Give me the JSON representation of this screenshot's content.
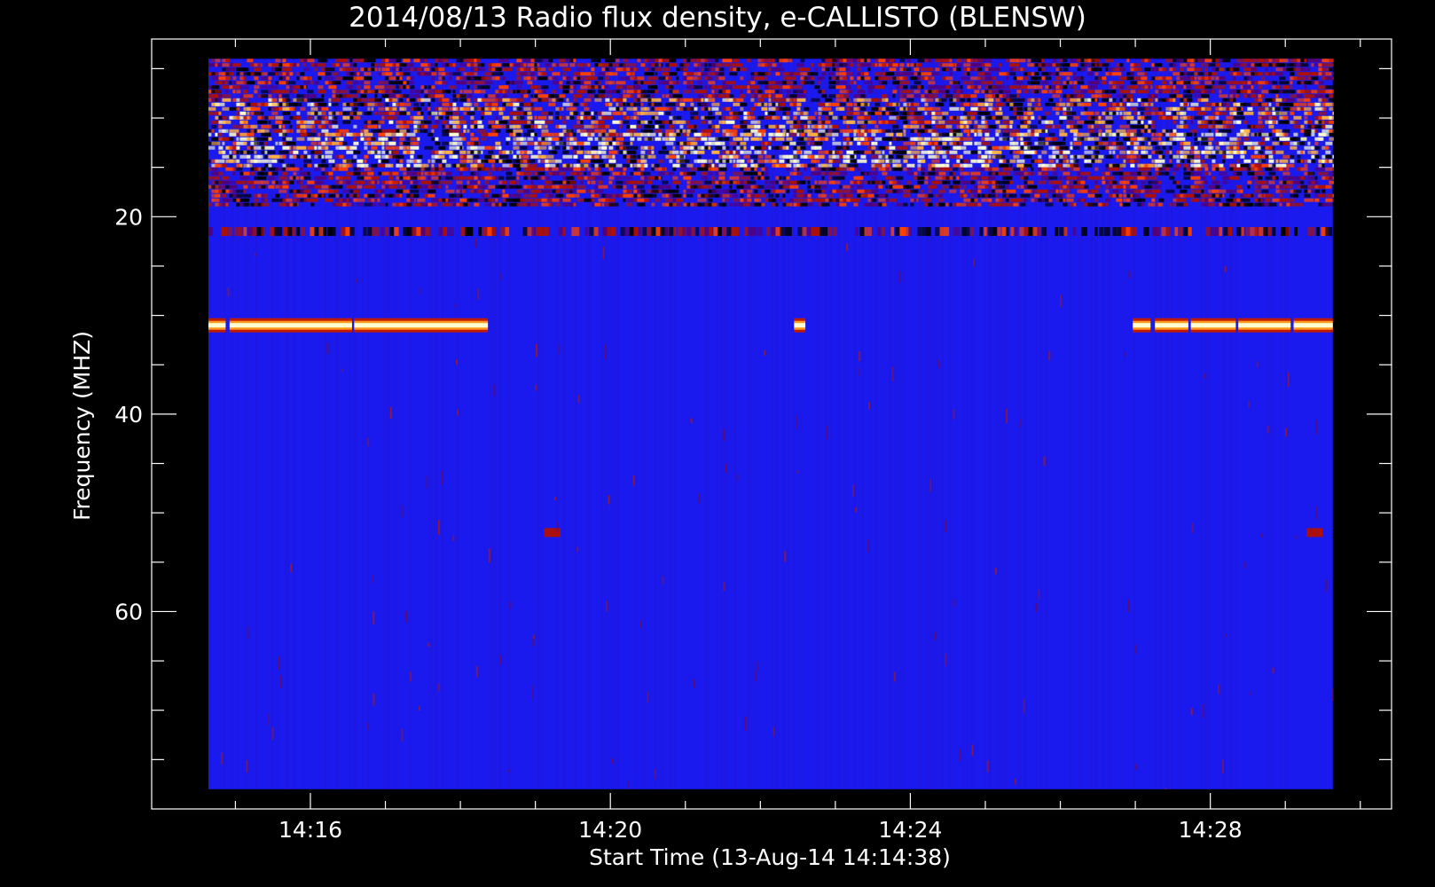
{
  "chart_data": {
    "type": "heatmap",
    "title": "2014/08/13  Radio flux density, e-CALLISTO (BLENSW)",
    "xlabel": "Start Time (13-Aug-14 14:14:38)",
    "ylabel": "Frequency (MHZ)",
    "x_unit": "UT time (HH:MM)",
    "xlim": [
      "14:13:53",
      "14:30:25"
    ],
    "data_xlim": [
      "14:14:38",
      "14:29:38"
    ],
    "ylim": [
      80,
      2
    ],
    "data_ylim": [
      78,
      4
    ],
    "x_major_ticks": [
      {
        "value": "14:16",
        "label": "14:16"
      },
      {
        "value": "14:20",
        "label": "14:20"
      },
      {
        "value": "14:24",
        "label": "14:24"
      },
      {
        "value": "14:28",
        "label": "14:28"
      }
    ],
    "x_minor_ticks": [
      "14:15",
      "14:17",
      "14:18",
      "14:19",
      "14:21",
      "14:22",
      "14:23",
      "14:25",
      "14:26",
      "14:27",
      "14:29",
      "14:30"
    ],
    "y_major_ticks": [
      {
        "value": 20,
        "label": "20"
      },
      {
        "value": 40,
        "label": "40"
      },
      {
        "value": 60,
        "label": "60"
      }
    ],
    "y_minor_ticks": [
      5,
      10,
      15,
      25,
      30,
      35,
      45,
      50,
      55,
      65,
      70,
      75
    ],
    "background_color": "#1a1aee",
    "colormap": [
      "#000000",
      "#550077",
      "#b01000",
      "#ff4000",
      "#ffb040",
      "#ffffd0"
    ],
    "features": [
      {
        "kind": "noisy-band",
        "freq_mhz": [
          4,
          8
        ],
        "intensity": "medium"
      },
      {
        "kind": "noisy-band",
        "freq_mhz": [
          8,
          11.5
        ],
        "intensity": "high"
      },
      {
        "kind": "noisy-band",
        "freq_mhz": [
          11.5,
          15
        ],
        "intensity": "very-high"
      },
      {
        "kind": "noisy-band",
        "freq_mhz": [
          15,
          19
        ],
        "intensity": "medium"
      },
      {
        "kind": "line",
        "freq_mhz": 21.5,
        "intensity": "medium"
      },
      {
        "kind": "carrier",
        "freq_mhz": 31,
        "time": [
          "14:14:38",
          "14:18:22"
        ]
      },
      {
        "kind": "carrier",
        "freq_mhz": 31,
        "time": [
          "14:22:27",
          "14:22:36"
        ]
      },
      {
        "kind": "carrier",
        "freq_mhz": 31,
        "time": [
          "14:26:58",
          "14:29:38"
        ]
      },
      {
        "kind": "blip",
        "freq_mhz": 52,
        "time": [
          "14:19:07",
          "14:19:20"
        ]
      },
      {
        "kind": "blip",
        "freq_mhz": 52,
        "time": [
          "14:29:17",
          "14:29:30"
        ]
      }
    ]
  }
}
